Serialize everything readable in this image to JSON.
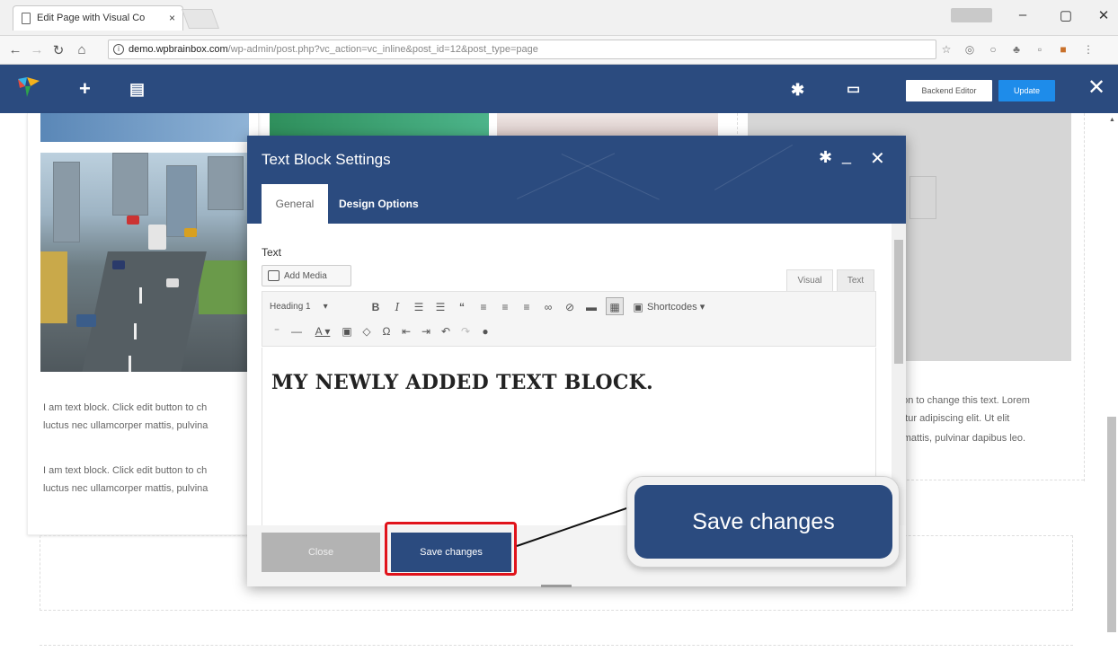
{
  "browser": {
    "tab_title": "Edit Page with Visual Co",
    "tab_close": "×",
    "url_host": "demo.wpbrainbox.com",
    "url_path": "/wp-admin/post.php?vc_action=vc_inline&post_id=12&post_type=page"
  },
  "vc_bar": {
    "backend_editor": "Backend Editor",
    "update": "Update"
  },
  "page": {
    "lorem_left_1a": "I am text block. Click edit button to ch",
    "lorem_left_1b": "luctus nec ullamcorper mattis, pulvina",
    "lorem_left_2a": "I am text block. Click edit button to ch",
    "lorem_left_2b": "luctus nec ullamcorper mattis, pulvina",
    "lorem_right_1": "tton to change this text. Lorem",
    "lorem_right_2": "tetur adipiscing elit. Ut elit",
    "lorem_right_3": "r mattis, pulvinar dapibus leo."
  },
  "modal": {
    "title": "Text Block Settings",
    "tabs": [
      "General",
      "Design Options"
    ],
    "field_label": "Text",
    "add_media": "Add Media",
    "editor_tabs": [
      "Visual",
      "Text"
    ],
    "format_select": "Heading 1",
    "shortcodes": "Shortcodes",
    "content": "MY NEWLY ADDED TEXT BLOCK.",
    "close": "Close",
    "save": "Save changes"
  },
  "callout": {
    "text": "Save changes"
  }
}
